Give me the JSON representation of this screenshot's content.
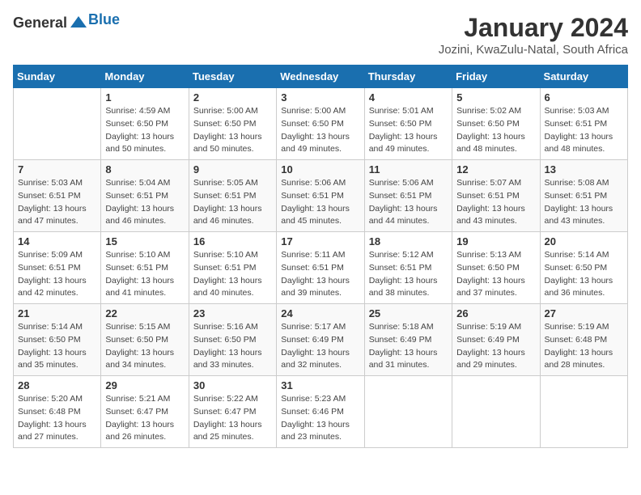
{
  "logo": {
    "general": "General",
    "blue": "Blue"
  },
  "title": "January 2024",
  "subtitle": "Jozini, KwaZulu-Natal, South Africa",
  "days_of_week": [
    "Sunday",
    "Monday",
    "Tuesday",
    "Wednesday",
    "Thursday",
    "Friday",
    "Saturday"
  ],
  "weeks": [
    [
      {
        "num": "",
        "info": ""
      },
      {
        "num": "1",
        "info": "Sunrise: 4:59 AM\nSunset: 6:50 PM\nDaylight: 13 hours\nand 50 minutes."
      },
      {
        "num": "2",
        "info": "Sunrise: 5:00 AM\nSunset: 6:50 PM\nDaylight: 13 hours\nand 50 minutes."
      },
      {
        "num": "3",
        "info": "Sunrise: 5:00 AM\nSunset: 6:50 PM\nDaylight: 13 hours\nand 49 minutes."
      },
      {
        "num": "4",
        "info": "Sunrise: 5:01 AM\nSunset: 6:50 PM\nDaylight: 13 hours\nand 49 minutes."
      },
      {
        "num": "5",
        "info": "Sunrise: 5:02 AM\nSunset: 6:50 PM\nDaylight: 13 hours\nand 48 minutes."
      },
      {
        "num": "6",
        "info": "Sunrise: 5:03 AM\nSunset: 6:51 PM\nDaylight: 13 hours\nand 48 minutes."
      }
    ],
    [
      {
        "num": "7",
        "info": "Sunrise: 5:03 AM\nSunset: 6:51 PM\nDaylight: 13 hours\nand 47 minutes."
      },
      {
        "num": "8",
        "info": "Sunrise: 5:04 AM\nSunset: 6:51 PM\nDaylight: 13 hours\nand 46 minutes."
      },
      {
        "num": "9",
        "info": "Sunrise: 5:05 AM\nSunset: 6:51 PM\nDaylight: 13 hours\nand 46 minutes."
      },
      {
        "num": "10",
        "info": "Sunrise: 5:06 AM\nSunset: 6:51 PM\nDaylight: 13 hours\nand 45 minutes."
      },
      {
        "num": "11",
        "info": "Sunrise: 5:06 AM\nSunset: 6:51 PM\nDaylight: 13 hours\nand 44 minutes."
      },
      {
        "num": "12",
        "info": "Sunrise: 5:07 AM\nSunset: 6:51 PM\nDaylight: 13 hours\nand 43 minutes."
      },
      {
        "num": "13",
        "info": "Sunrise: 5:08 AM\nSunset: 6:51 PM\nDaylight: 13 hours\nand 43 minutes."
      }
    ],
    [
      {
        "num": "14",
        "info": "Sunrise: 5:09 AM\nSunset: 6:51 PM\nDaylight: 13 hours\nand 42 minutes."
      },
      {
        "num": "15",
        "info": "Sunrise: 5:10 AM\nSunset: 6:51 PM\nDaylight: 13 hours\nand 41 minutes."
      },
      {
        "num": "16",
        "info": "Sunrise: 5:10 AM\nSunset: 6:51 PM\nDaylight: 13 hours\nand 40 minutes."
      },
      {
        "num": "17",
        "info": "Sunrise: 5:11 AM\nSunset: 6:51 PM\nDaylight: 13 hours\nand 39 minutes."
      },
      {
        "num": "18",
        "info": "Sunrise: 5:12 AM\nSunset: 6:51 PM\nDaylight: 13 hours\nand 38 minutes."
      },
      {
        "num": "19",
        "info": "Sunrise: 5:13 AM\nSunset: 6:50 PM\nDaylight: 13 hours\nand 37 minutes."
      },
      {
        "num": "20",
        "info": "Sunrise: 5:14 AM\nSunset: 6:50 PM\nDaylight: 13 hours\nand 36 minutes."
      }
    ],
    [
      {
        "num": "21",
        "info": "Sunrise: 5:14 AM\nSunset: 6:50 PM\nDaylight: 13 hours\nand 35 minutes."
      },
      {
        "num": "22",
        "info": "Sunrise: 5:15 AM\nSunset: 6:50 PM\nDaylight: 13 hours\nand 34 minutes."
      },
      {
        "num": "23",
        "info": "Sunrise: 5:16 AM\nSunset: 6:50 PM\nDaylight: 13 hours\nand 33 minutes."
      },
      {
        "num": "24",
        "info": "Sunrise: 5:17 AM\nSunset: 6:49 PM\nDaylight: 13 hours\nand 32 minutes."
      },
      {
        "num": "25",
        "info": "Sunrise: 5:18 AM\nSunset: 6:49 PM\nDaylight: 13 hours\nand 31 minutes."
      },
      {
        "num": "26",
        "info": "Sunrise: 5:19 AM\nSunset: 6:49 PM\nDaylight: 13 hours\nand 29 minutes."
      },
      {
        "num": "27",
        "info": "Sunrise: 5:19 AM\nSunset: 6:48 PM\nDaylight: 13 hours\nand 28 minutes."
      }
    ],
    [
      {
        "num": "28",
        "info": "Sunrise: 5:20 AM\nSunset: 6:48 PM\nDaylight: 13 hours\nand 27 minutes."
      },
      {
        "num": "29",
        "info": "Sunrise: 5:21 AM\nSunset: 6:47 PM\nDaylight: 13 hours\nand 26 minutes."
      },
      {
        "num": "30",
        "info": "Sunrise: 5:22 AM\nSunset: 6:47 PM\nDaylight: 13 hours\nand 25 minutes."
      },
      {
        "num": "31",
        "info": "Sunrise: 5:23 AM\nSunset: 6:46 PM\nDaylight: 13 hours\nand 23 minutes."
      },
      {
        "num": "",
        "info": ""
      },
      {
        "num": "",
        "info": ""
      },
      {
        "num": "",
        "info": ""
      }
    ]
  ]
}
